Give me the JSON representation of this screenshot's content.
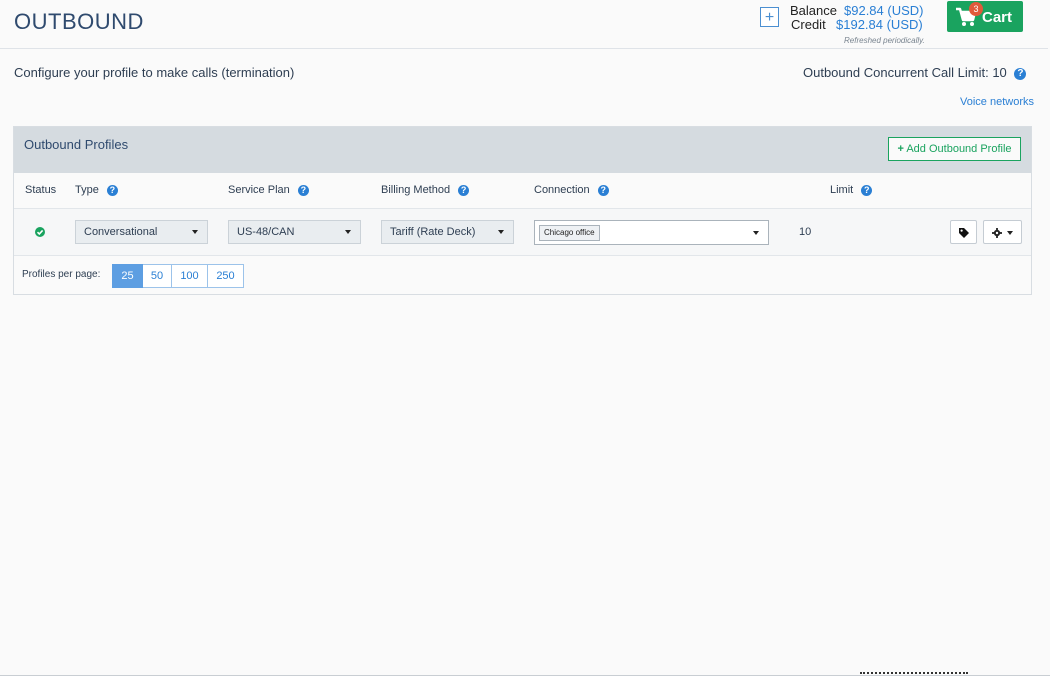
{
  "header": {
    "title": "OUTBOUND",
    "add_funds_icon": "plus-icon",
    "balance_label": "Balance",
    "balance_value": "$92.84 (USD)",
    "credit_label": "Credit",
    "credit_value": "$192.84 (USD)",
    "refreshed_note": "Refreshed periodically.",
    "cart": {
      "label": "Cart",
      "count": "3",
      "icon": "shopping-cart-icon",
      "color": "#1aa35f"
    }
  },
  "intro": {
    "subtitle": "Configure your profile to make calls (termination)",
    "concurrent_limit": "Outbound Concurrent Call Limit: 10",
    "voice_networks_link": "Voice networks"
  },
  "panel": {
    "title": "Outbound Profiles",
    "add_button": "Add Outbound Profile",
    "columns": [
      "Status",
      "Type",
      "Service Plan",
      "Billing Method",
      "Connection",
      "Limit"
    ],
    "rows": [
      {
        "status": "active",
        "type": "Conversational",
        "service_plan": "US-48/CAN",
        "billing_method": "Tariff (Rate Deck)",
        "connection": "Chicago office",
        "limit": "10"
      }
    ],
    "pagination": {
      "label": "Profiles per page:",
      "options": [
        "25",
        "50",
        "100",
        "250"
      ],
      "selected": "25"
    }
  },
  "colors": {
    "accent": "#2a7fd4",
    "success": "#1aa35f",
    "badge": "#e05a3b"
  }
}
